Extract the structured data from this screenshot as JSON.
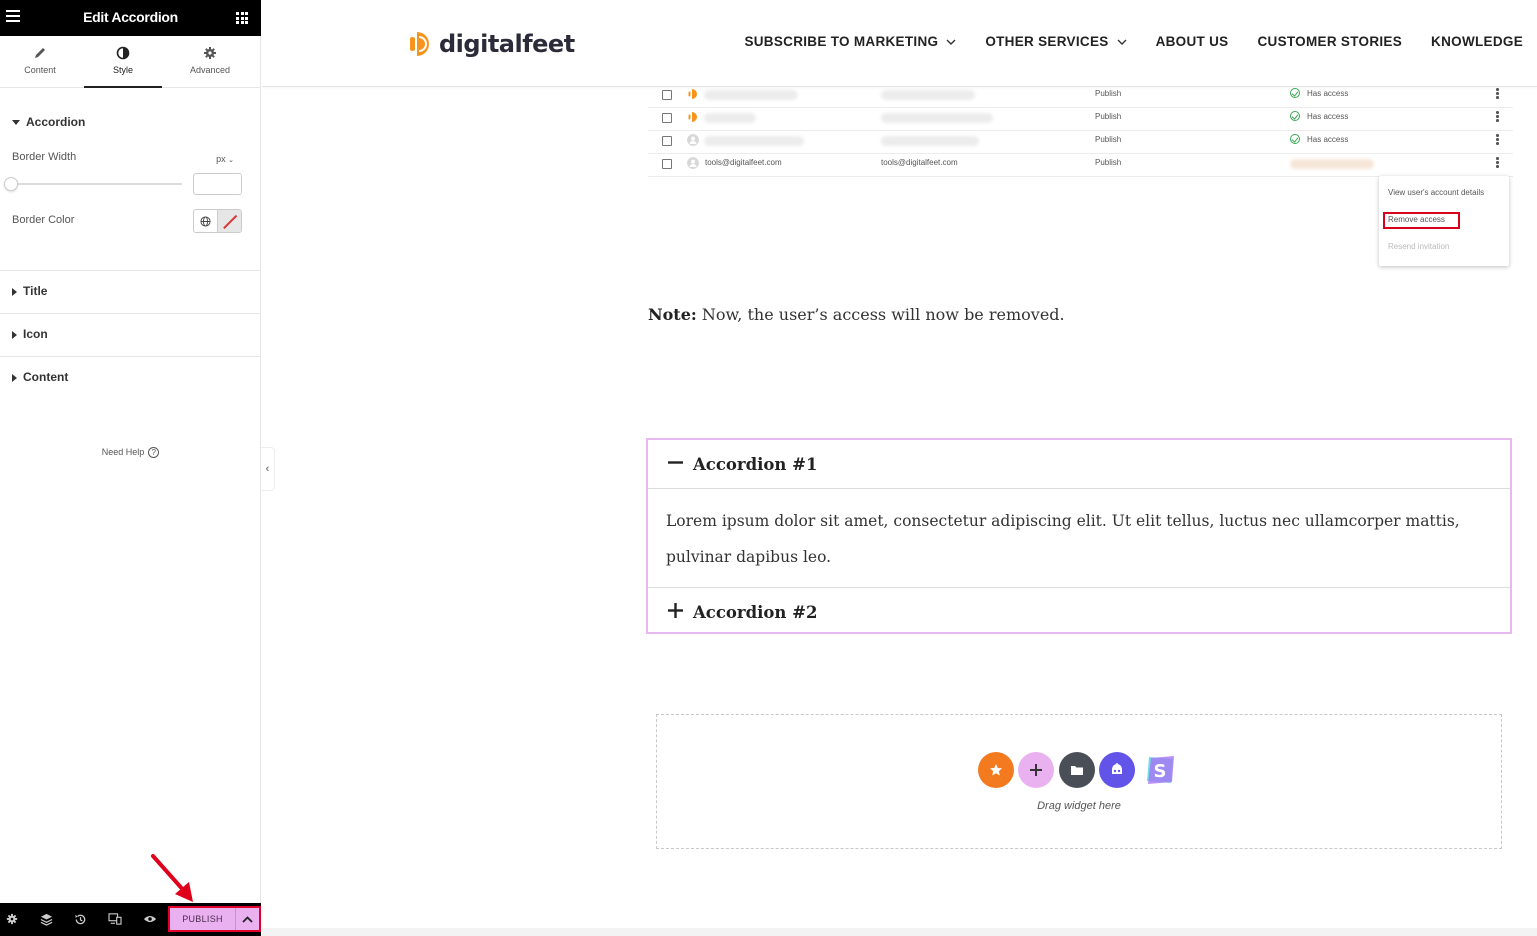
{
  "editor": {
    "title": "Edit Accordion",
    "tabs": [
      {
        "label": "Content"
      },
      {
        "label": "Style"
      },
      {
        "label": "Advanced"
      }
    ],
    "sections": {
      "accordion": "Accordion",
      "title": "Title",
      "icon": "Icon",
      "content": "Content"
    },
    "controls": {
      "border_width_label": "Border Width",
      "border_width_unit": "px",
      "border_width_value": "",
      "border_color_label": "Border Color"
    },
    "need_help": "Need Help",
    "footer": {
      "publish_label": "PUBLISH"
    }
  },
  "site": {
    "logo_text": "digitalfeet",
    "nav": [
      {
        "label": "SUBSCRIBE TO MARKETING",
        "has_dropdown": true
      },
      {
        "label": "OTHER SERVICES",
        "has_dropdown": true
      },
      {
        "label": "ABOUT US",
        "has_dropdown": false
      },
      {
        "label": "CUSTOMER STORIES",
        "has_dropdown": false
      },
      {
        "label": "KNOWLEDGE",
        "has_dropdown": false
      }
    ]
  },
  "screenshot": {
    "rows": [
      {
        "status": "Publish",
        "access": "Has access"
      },
      {
        "status": "Publish",
        "access": "Has access"
      },
      {
        "status": "Publish",
        "access": "Has access"
      },
      {
        "name": "tools@digitalfeet.com",
        "email": "tools@digitalfeet.com",
        "status": "Publish"
      }
    ],
    "menu": {
      "view": "View user's account details",
      "remove": "Remove access",
      "resend": "Resend invitation"
    }
  },
  "note": {
    "bold": "Note:",
    "text": " Now, the user’s access will now be removed."
  },
  "accordion": {
    "item1_title": "Accordion #1",
    "item1_body": "Lorem ipsum dolor sit amet, consectetur adipiscing elit. Ut elit tellus, luctus nec ullamcorper mattis, pulvinar dapibus leo.",
    "item2_title": "Accordion #2"
  },
  "dropzone": {
    "label": "Drag widget here"
  },
  "colors": {
    "accent_pink": "#eab1f0",
    "accordion_border": "#e7b8ef",
    "highlight_red": "#e0002a",
    "logo_orange": "#f7941d"
  }
}
